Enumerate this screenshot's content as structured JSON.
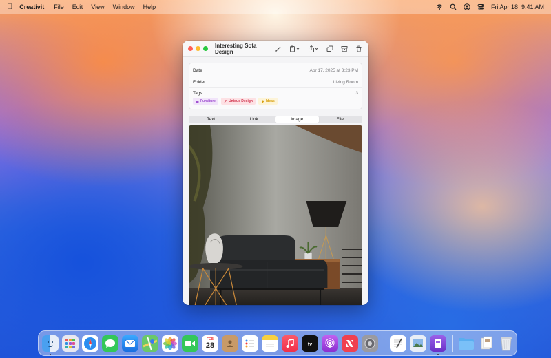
{
  "menubar": {
    "app_name": "Creativit",
    "menus": [
      "File",
      "Edit",
      "View",
      "Window",
      "Help"
    ],
    "datetime": "Fri Apr 18  9:41 AM"
  },
  "window": {
    "title": "Interesting Sofa Design",
    "fields": {
      "date_label": "Date",
      "date_value": "Apr 17, 2025 at 3:23 PM",
      "folder_label": "Folder",
      "folder_value": "Living Room",
      "tags_label": "Tags",
      "tags_count": "3"
    },
    "tags": [
      {
        "label": "Furniture",
        "color": "#a050d0"
      },
      {
        "label": "Unique Design",
        "color": "#d0304a"
      },
      {
        "label": "Ideas",
        "color": "#d8a010"
      }
    ],
    "tabs": [
      "Text",
      "Link",
      "Image",
      "File"
    ],
    "active_tab": "Image"
  },
  "dock": {
    "calendar_month": "FEB",
    "calendar_day": "28",
    "apps": [
      "finder-icon",
      "launchpad-icon",
      "safari-icon",
      "messages-icon",
      "mail-icon",
      "maps-icon",
      "photos-icon",
      "facetime-icon",
      "calendar-icon",
      "contacts-icon",
      "reminders-icon",
      "notes-icon",
      "music-icon",
      "tv-icon",
      "podcasts-icon",
      "news-icon",
      "settings-icon",
      "textedit-icon",
      "preview-icon",
      "creativit-icon",
      "folder-icon",
      "documents-icon",
      "trash-icon"
    ]
  }
}
